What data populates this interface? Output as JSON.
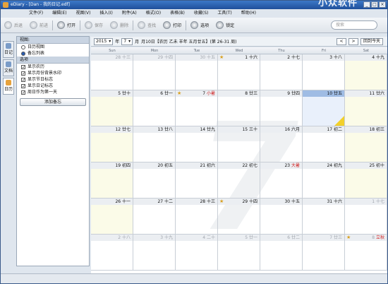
{
  "app": {
    "title": "eDiary - [Dan - 我的日记.edf]",
    "watermark": "小众软件"
  },
  "window_buttons": [
    "_",
    "□",
    "×"
  ],
  "menu": [
    "文件(F)",
    "编辑(E)",
    "视图(V)",
    "插入(I)",
    "附件(A)",
    "格式(O)",
    "表格(B)",
    "收藏(S)",
    "工具(T)",
    "帮助(H)"
  ],
  "toolbar": {
    "back": "后退",
    "forward": "前进",
    "open": "打开",
    "save": "保存",
    "delete": "删除",
    "find": "查找",
    "print": "打印",
    "options": "选项",
    "lock": "锁定",
    "search_placeholder": "搜索"
  },
  "left_tabs": [
    "日记",
    "文档",
    "日历"
  ],
  "side": {
    "view_header": "视图:",
    "views": [
      {
        "label": "日历视图",
        "selected": false
      },
      {
        "label": "备忘列表",
        "selected": true
      }
    ],
    "options_header": "选项",
    "options": [
      "显示农历",
      "显示月份背景水印",
      "显示节日标志",
      "显示日记标志",
      "周日作为第一天"
    ],
    "add_memo": "添加备忘"
  },
  "nav": {
    "year": "2015",
    "year_unit": "年",
    "month": "7",
    "month_unit": "月",
    "info": "月10日【农历 乙未 羊年 五月廿五】(第 26-31 周)",
    "prev": "<",
    "next": ">",
    "today": "回到今天"
  },
  "month_watermark": "7",
  "day_names": [
    "Sun",
    "Mon",
    "Tue",
    "Wed",
    "Thu",
    "Fri",
    "Sat"
  ],
  "weeks": [
    [
      {
        "d": "28",
        "l": "十三",
        "o": true
      },
      {
        "d": "29",
        "l": "十四",
        "o": true
      },
      {
        "d": "30",
        "l": "十五",
        "o": true
      },
      {
        "d": "1",
        "l": "十六",
        "s": true
      },
      {
        "d": "2",
        "l": "十七"
      },
      {
        "d": "3",
        "l": "十八"
      },
      {
        "d": "4",
        "l": "十九"
      }
    ],
    [
      {
        "d": "5",
        "l": "廿十"
      },
      {
        "d": "6",
        "l": "廿一"
      },
      {
        "d": "7",
        "l": "小暑",
        "r": true,
        "s": true
      },
      {
        "d": "8",
        "l": "廿三"
      },
      {
        "d": "9",
        "l": "廿四"
      },
      {
        "d": "10",
        "l": "廿五",
        "t": true
      },
      {
        "d": "11",
        "l": "廿六"
      }
    ],
    [
      {
        "d": "12",
        "l": "廿七"
      },
      {
        "d": "13",
        "l": "廿八"
      },
      {
        "d": "14",
        "l": "廿九"
      },
      {
        "d": "15",
        "l": "三十"
      },
      {
        "d": "16",
        "l": "六月"
      },
      {
        "d": "17",
        "l": "初二"
      },
      {
        "d": "18",
        "l": "初三"
      }
    ],
    [
      {
        "d": "19",
        "l": "初四"
      },
      {
        "d": "20",
        "l": "初五"
      },
      {
        "d": "21",
        "l": "初六"
      },
      {
        "d": "22",
        "l": "初七"
      },
      {
        "d": "23",
        "l": "大暑",
        "r": true
      },
      {
        "d": "24",
        "l": "初九"
      },
      {
        "d": "25",
        "l": "初十"
      }
    ],
    [
      {
        "d": "26",
        "l": "十一"
      },
      {
        "d": "27",
        "l": "十二"
      },
      {
        "d": "28",
        "l": "十三"
      },
      {
        "d": "29",
        "l": "十四",
        "s": true
      },
      {
        "d": "30",
        "l": "十五"
      },
      {
        "d": "31",
        "l": "十六"
      },
      {
        "d": "1",
        "l": "十七",
        "o": true
      }
    ],
    [
      {
        "d": "2",
        "l": "十八",
        "o": true
      },
      {
        "d": "3",
        "l": "十九",
        "o": true
      },
      {
        "d": "4",
        "l": "二十",
        "o": true
      },
      {
        "d": "5",
        "l": "廿一",
        "o": true
      },
      {
        "d": "6",
        "l": "廿二",
        "o": true
      },
      {
        "d": "7",
        "l": "廿三",
        "o": true
      },
      {
        "d": "8",
        "l": "立秋",
        "o": true,
        "r": true,
        "s": true
      }
    ]
  ]
}
